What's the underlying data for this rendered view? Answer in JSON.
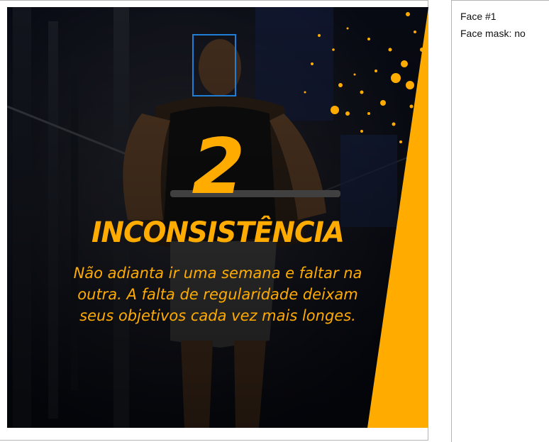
{
  "image": {
    "big_number": "2",
    "headline": "INCONSISTÊNCIA",
    "body_lines": [
      "Não adianta ir uma semana e faltar na",
      "outra. A falta de regularidade deixam",
      "seus objetivos cada vez mais longes."
    ],
    "accent_color": "#ffab00",
    "face_box_color": "#1f7fd6"
  },
  "info": {
    "face_label": "Face #1",
    "mask_label": "Face mask: no"
  }
}
